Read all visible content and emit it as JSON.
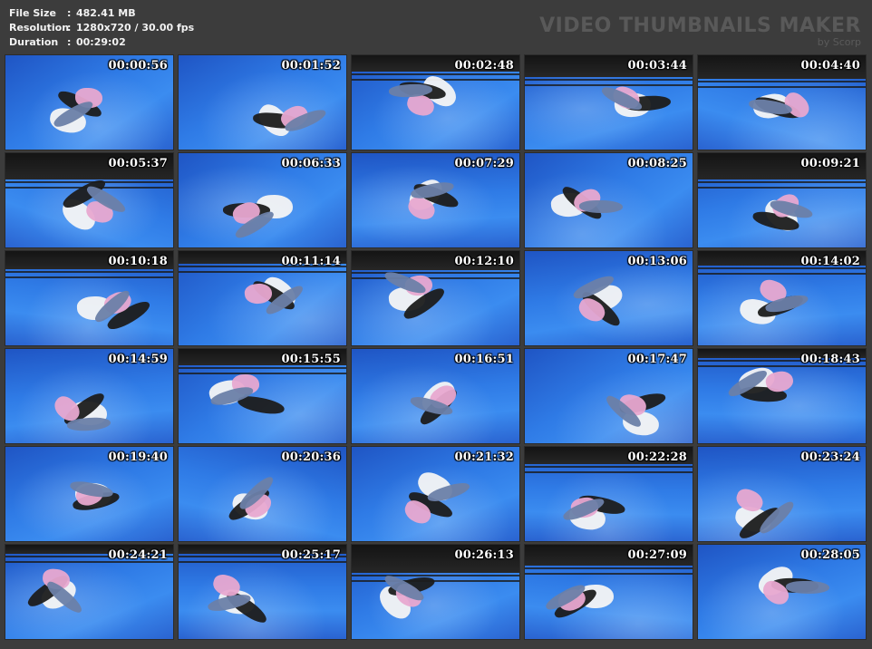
{
  "info": {
    "file_size_label": "File Size",
    "file_size_value": "482.41 MB",
    "resolution_label": "Resolution",
    "resolution_value": "1280x720 / 30.00 fps",
    "duration_label": "Duration",
    "duration_value": "00:29:02",
    "separator": ":"
  },
  "brand": {
    "title": "VIDEO THUMBNAILS MAKER",
    "by": "by Scorp"
  },
  "thumbnails": [
    "00:00:56",
    "00:01:52",
    "00:02:48",
    "00:03:44",
    "00:04:40",
    "00:05:37",
    "00:06:33",
    "00:07:29",
    "00:08:25",
    "00:09:21",
    "00:10:18",
    "00:11:14",
    "00:12:10",
    "00:13:06",
    "00:14:02",
    "00:14:59",
    "00:15:55",
    "00:16:51",
    "00:17:47",
    "00:18:43",
    "00:19:40",
    "00:20:36",
    "00:21:32",
    "00:22:28",
    "00:23:24",
    "00:24:21",
    "00:25:17",
    "00:26:13",
    "00:27:09",
    "00:28:05"
  ],
  "colors": {
    "background": "#3c3c3c",
    "mat_blue": "#2f7be6",
    "shirt_white": "#f4f4f4",
    "top_pink": "#e8a8d0",
    "pants_dark": "#1c1c1c",
    "jeans": "#6b7fa8"
  }
}
